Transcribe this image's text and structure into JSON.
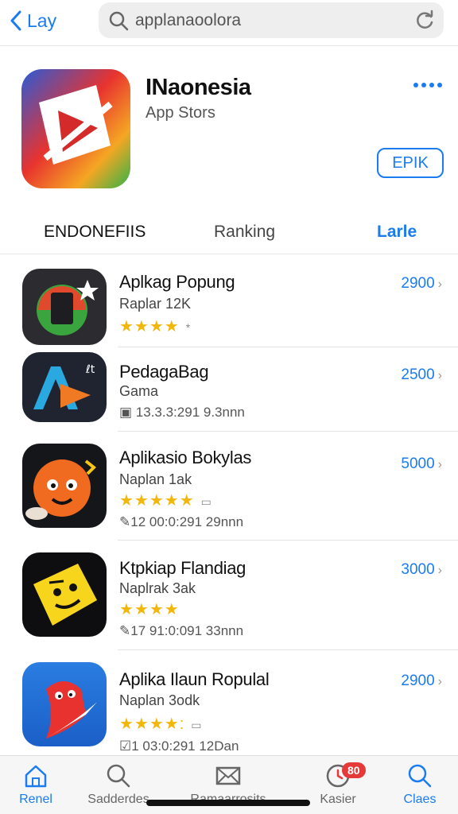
{
  "nav": {
    "back_label": "Lay"
  },
  "search": {
    "value": "applanaoolora"
  },
  "app": {
    "title": "INaonesia",
    "subtitle": "App Stors",
    "get_label": "EPIK"
  },
  "tabs": [
    "ENDONEFIIS",
    "Ranking",
    "Larle"
  ],
  "apps": [
    {
      "name": "Aplkag Popung",
      "sub": "Raplar 12K",
      "stars": "★★★★",
      "extra": "*",
      "meta": "",
      "price": "2900"
    },
    {
      "name": "PedagaBag",
      "sub": "Gama",
      "stars": "",
      "extra": "",
      "meta": "13.3.3:291 9.3nnn",
      "price": "2500"
    },
    {
      "name": "Aplikasio Bokylas",
      "sub": "Naplan 1ak",
      "stars": "★★★★★",
      "extra": "▭",
      "meta": "12 00:0:291 29nnn",
      "price": "5000"
    },
    {
      "name": "Ktpkiap Flandiag",
      "sub": "Naplrak 3ak",
      "stars": "★★★★",
      "extra": "",
      "meta": "17 91:0:091 33nnn",
      "price": "3000"
    },
    {
      "name": "Aplika Ilaun Ropulal",
      "sub": "Naplan 3odk",
      "stars": "★★★★:",
      "extra": "▭",
      "meta": "1 03:0:291 12Dan",
      "price": "2900"
    }
  ],
  "tabbar": [
    {
      "label": "Renel",
      "icon": "home-icon"
    },
    {
      "label": "Sadderdes",
      "icon": "search-icon"
    },
    {
      "label": "Ramaarrosits",
      "icon": "mail-icon"
    },
    {
      "label": "Kasier",
      "icon": "clock-icon",
      "badge": "80"
    },
    {
      "label": "Claes",
      "icon": "search-icon"
    }
  ],
  "colors": {
    "accent": "#1a7cf0",
    "star": "#f2b70d",
    "badge": "#e53a3a"
  }
}
